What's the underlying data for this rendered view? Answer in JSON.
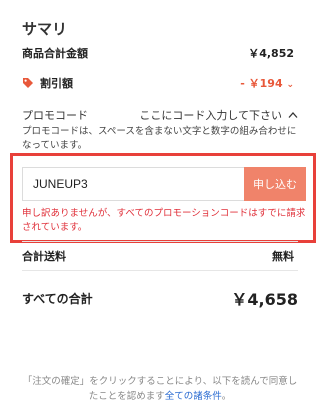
{
  "summary": {
    "title": "サマリ",
    "subtotal_label": "商品合計金額",
    "subtotal_value": "￥4,852",
    "discount_label": "割引額",
    "discount_value": "- ￥194",
    "discount_arrow": "⌄"
  },
  "promo": {
    "label": "プロモコード",
    "hint": "ここにコード入力して下さい",
    "description": "プロモコードは、スペースを含まない文字と数字の組み合わせになっています。",
    "input_value": "JUNEUP3",
    "apply_label": "申し込む",
    "error": "申し訳ありませんが、すべてのプロモーションコードはすでに請求されています。"
  },
  "shipping": {
    "label": "合計送料",
    "value": "無料"
  },
  "grand_total": {
    "label": "すべての合計",
    "value": "￥4,658"
  },
  "footer": {
    "text": "「注文の確定」をクリックすることにより、以下を読んで同意したことを認めます",
    "link": "全ての諸条件",
    "end": "。"
  },
  "colors": {
    "accent": "#e8583a",
    "button": "#f0836a",
    "error": "#e0303a",
    "link": "#2a6bd1"
  },
  "icons": {
    "discount": "tag-icon",
    "promo_toggle": "chevron-up-icon"
  }
}
